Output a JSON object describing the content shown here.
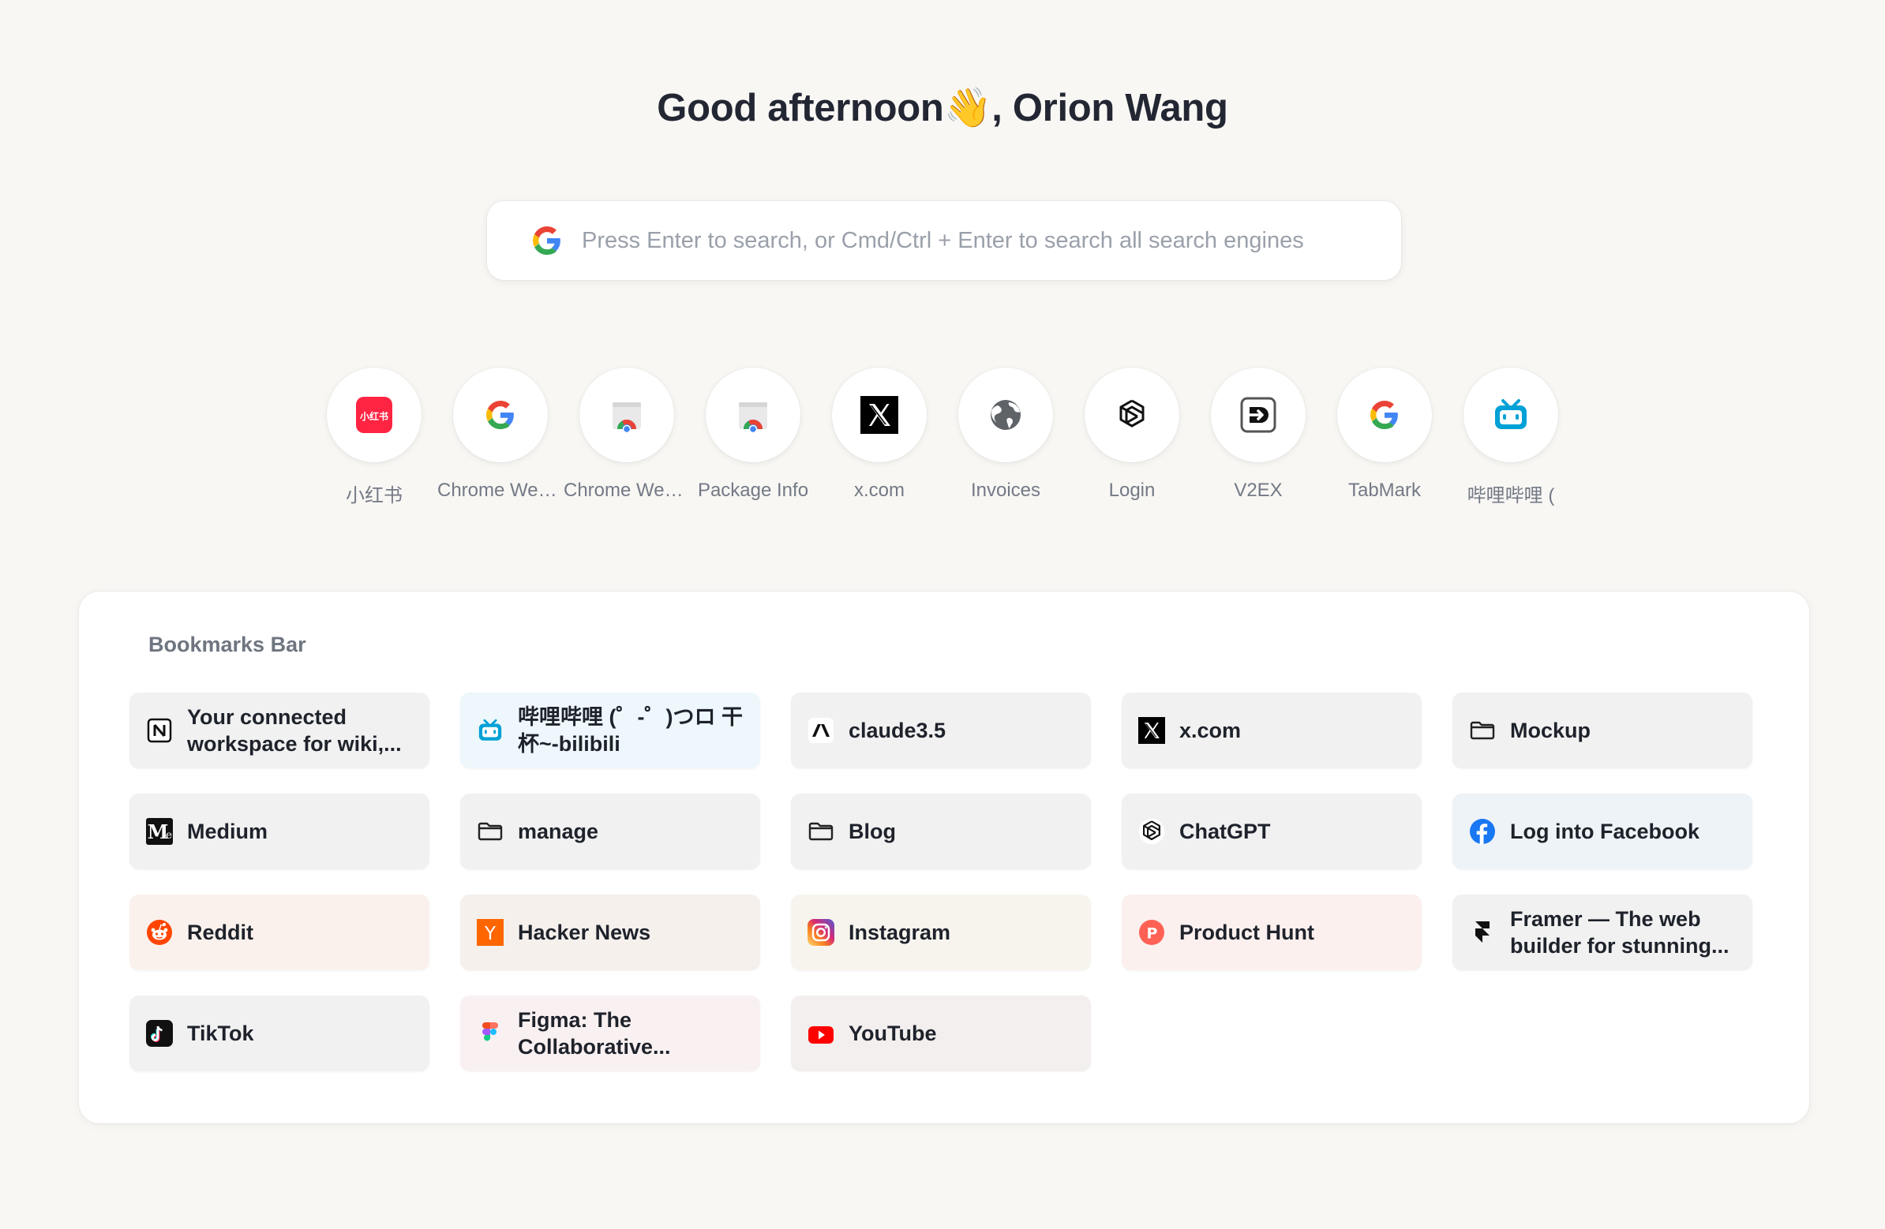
{
  "greeting": "Good afternoon👋, Orion Wang",
  "search": {
    "placeholder": "Press Enter to search, or Cmd/Ctrl + Enter to search all search engines",
    "engine_icon": "google-icon"
  },
  "shortcuts": [
    {
      "label": "小红书",
      "icon": "xiaohongshu-icon",
      "icon_text": "小红书",
      "color": "#ff2442"
    },
    {
      "label": "Chrome Web Store",
      "icon": "google-icon"
    },
    {
      "label": "Chrome Web Store",
      "icon": "chrome-webstore-icon"
    },
    {
      "label": "Package Info",
      "icon": "chrome-webstore-icon"
    },
    {
      "label": "x.com",
      "icon": "x-icon"
    },
    {
      "label": "Invoices",
      "icon": "globe-icon"
    },
    {
      "label": "Login",
      "icon": "openai-icon"
    },
    {
      "label": "V2EX",
      "icon": "v2ex-icon"
    },
    {
      "label": "TabMark",
      "icon": "google-icon"
    },
    {
      "label": "哔哩哔哩 (",
      "icon": "bilibili-icon",
      "color": "#00a1d6"
    }
  ],
  "bookmarks": {
    "title": "Bookmarks Bar",
    "items": [
      {
        "label": "Your connected workspace for wiki,...",
        "icon": "notion-icon",
        "tint": "#f1f1f1"
      },
      {
        "label": "哔哩哔哩 (゜-゜)つロ 干杯~-bilibili",
        "icon": "bilibili-icon",
        "tint": "#eef7fb"
      },
      {
        "label": "claude3.5",
        "icon": "anthropic-icon",
        "tint": "#f1f1f1"
      },
      {
        "label": "x.com",
        "icon": "x-icon",
        "tint": "#f1f1f1"
      },
      {
        "label": "Mockup",
        "icon": "folder-icon",
        "tint": "#f1f1f1"
      },
      {
        "label": "Medium",
        "icon": "medium-icon",
        "icon_text": "M",
        "tint": "#f1f1f1"
      },
      {
        "label": "manage",
        "icon": "folder-icon",
        "tint": "#f1f1f1"
      },
      {
        "label": "Blog",
        "icon": "folder-icon",
        "tint": "#f1f1f1"
      },
      {
        "label": "ChatGPT",
        "icon": "openai-icon",
        "tint": "#f1f1f1"
      },
      {
        "label": "Log into Facebook",
        "icon": "facebook-icon",
        "tint": "#eef3f8"
      },
      {
        "label": "Reddit",
        "icon": "reddit-icon",
        "tint": "#fbf1ec"
      },
      {
        "label": "Hacker News",
        "icon": "hackernews-icon",
        "icon_text": "Y",
        "tint": "#f5f0ec"
      },
      {
        "label": "Instagram",
        "icon": "instagram-icon",
        "tint": "#f7f4ee"
      },
      {
        "label": "Product Hunt",
        "icon": "producthunt-icon",
        "icon_text": "P",
        "tint": "#fbf0ee"
      },
      {
        "label": "Framer — The web builder for stunning...",
        "icon": "framer-icon",
        "tint": "#f1f1f1"
      },
      {
        "label": "TikTok",
        "icon": "tiktok-icon",
        "tint": "#f1f1f1"
      },
      {
        "label": "Figma: The Collaborative...",
        "icon": "figma-icon",
        "tint": "#f9f0f1"
      },
      {
        "label": "YouTube",
        "icon": "youtube-icon",
        "tint": "#f3efee"
      }
    ]
  }
}
